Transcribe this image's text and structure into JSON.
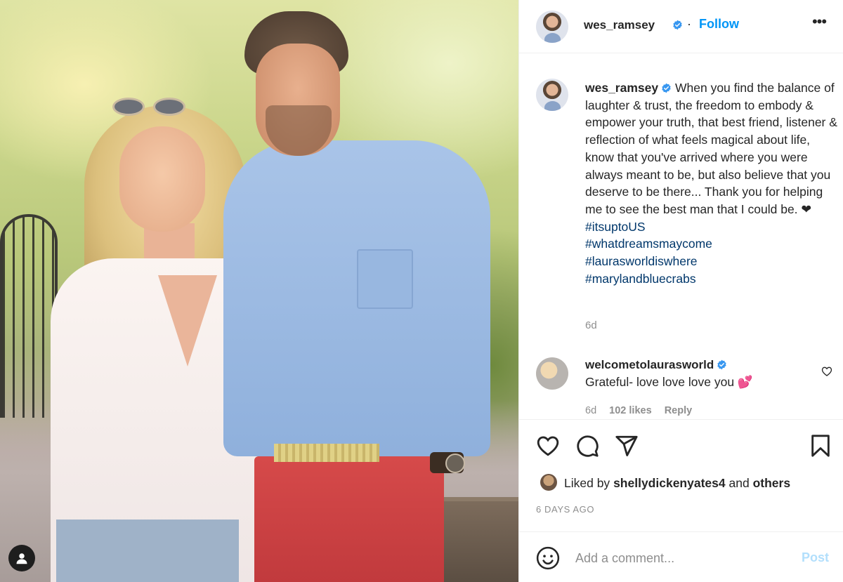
{
  "post": {
    "author": "wes_ramsey",
    "follow_label": "Follow",
    "separator": "·",
    "more_label": "•••"
  },
  "caption": {
    "username": "wes_ramsey",
    "text": "When you find the balance of laughter & trust, the freedom to embody & empower your truth, that best friend, listener & reflection of what feels magical about life, know that you've arrived where you were always meant to be, but also believe that you deserve to be there... Thank you for helping me to see the best man that I could be. ❤",
    "hashtags": [
      "#itsuptoUS",
      "#whatdreamsmaycome",
      "#laurasworldiswhere",
      "#marylandbluecrabs"
    ],
    "time": "6d"
  },
  "comment": {
    "username": "welcometolaurasworld",
    "text": "Grateful- love love love you 💕",
    "time": "6d",
    "likes": "102 likes",
    "reply_label": "Reply"
  },
  "likes": {
    "prefix": "Liked by",
    "user": "shellydickenyates4",
    "connector": "and",
    "others": "others"
  },
  "timestamp": "6 DAYS AGO",
  "add_comment": {
    "placeholder": "Add a comment...",
    "post_label": "Post"
  },
  "colors": {
    "accent": "#0095f6",
    "post_disabled": "#b2dffc",
    "hashtag": "#00376b",
    "verified": "#3897f0"
  },
  "icons": [
    "verified-badge-icon",
    "more-options-icon",
    "heart-icon",
    "comment-icon",
    "share-icon",
    "bookmark-icon",
    "emoji-icon",
    "user-tag-icon"
  ]
}
